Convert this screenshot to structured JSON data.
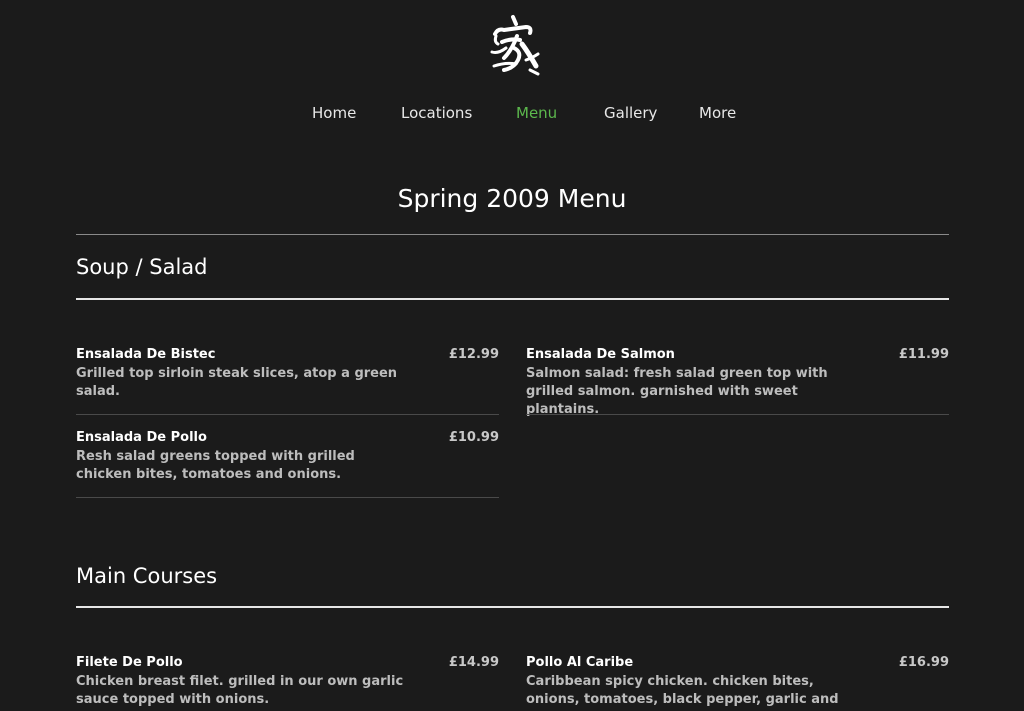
{
  "logo": {
    "icon": "calligraphy-logo-icon"
  },
  "nav": {
    "items": [
      {
        "label": "Home",
        "active": false
      },
      {
        "label": "Locations",
        "active": false
      },
      {
        "label": "Menu",
        "active": true
      },
      {
        "label": "Gallery",
        "active": false
      },
      {
        "label": "More",
        "active": false
      }
    ],
    "active_color": "#5cb84d"
  },
  "page_title": "Spring 2009 Menu",
  "sections": [
    {
      "title": "Soup / Salad",
      "items": [
        {
          "name": "Ensalada De Bistec",
          "price": "£12.99",
          "description": "Grilled top sirloin steak slices, atop a green salad."
        },
        {
          "name": "Ensalada De Salmon",
          "price": "£11.99",
          "description": "Salmon salad: fresh salad green top with grilled salmon. garnished with sweet plantains."
        },
        {
          "name": "Ensalada De Pollo",
          "price": "£10.99",
          "description": "Resh salad greens topped with grilled chicken bites, tomatoes and onions."
        }
      ]
    },
    {
      "title": "Main Courses",
      "items": [
        {
          "name": "Filete De Pollo",
          "price": "£14.99",
          "description": "Chicken breast filet. grilled in our own garlic sauce topped with onions."
        },
        {
          "name": "Pollo Al Caribe",
          "price": "£16.99",
          "description": "Caribbean spicy chicken. chicken bites, onions, tomatoes, black pepper, garlic and serrano"
        }
      ]
    }
  ]
}
